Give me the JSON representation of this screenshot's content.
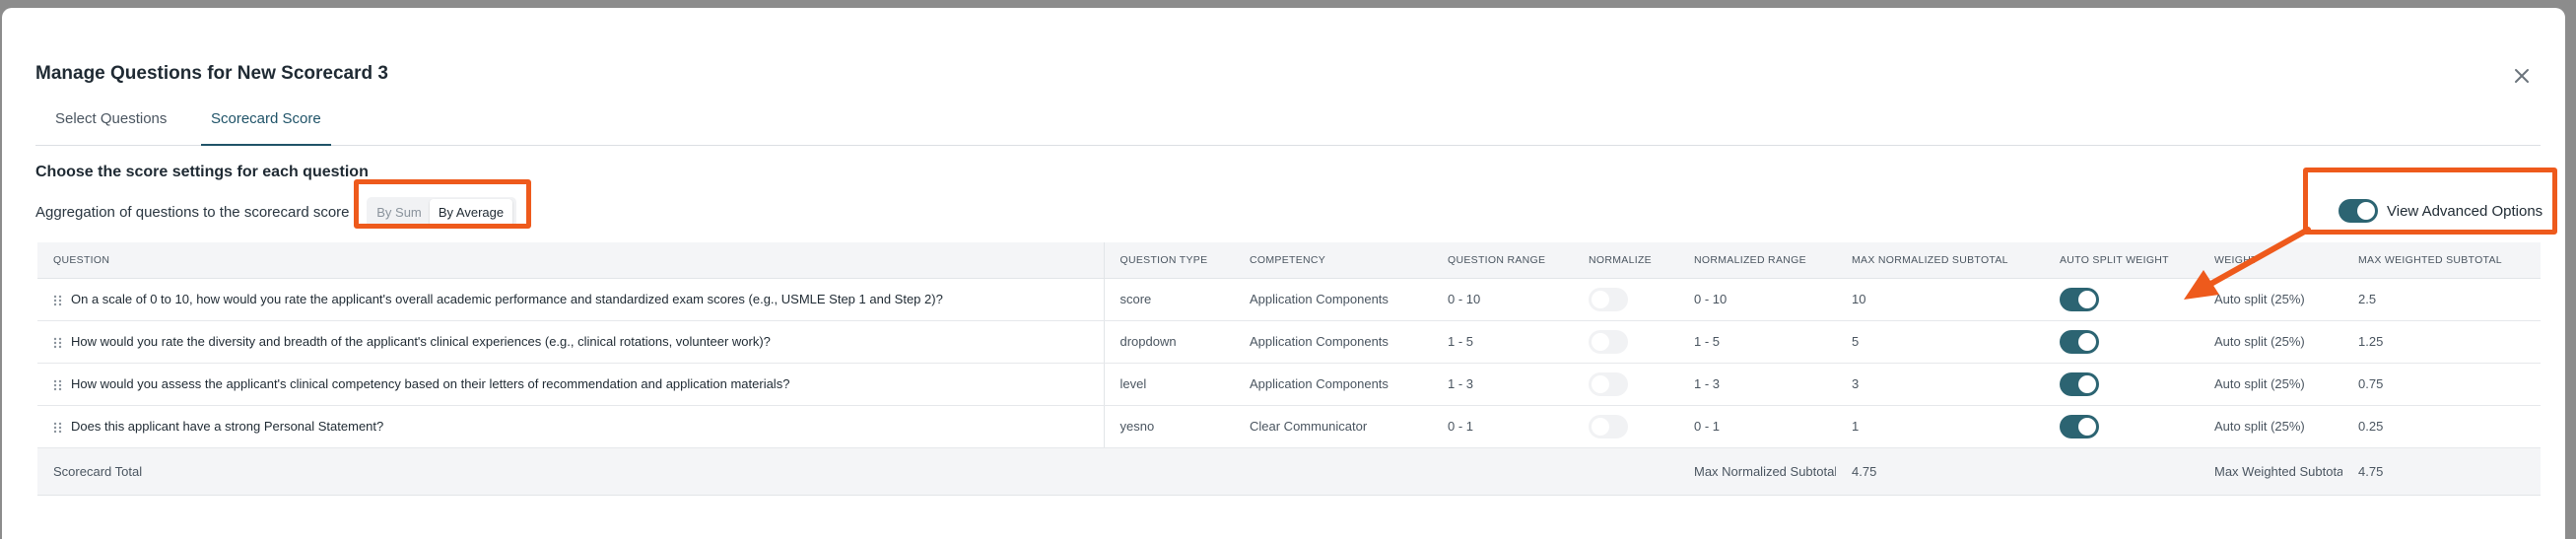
{
  "modal": {
    "title": "Manage Questions for New Scorecard 3"
  },
  "tabs": [
    {
      "label": "Select Questions",
      "active": false
    },
    {
      "label": "Scorecard Score",
      "active": true
    }
  ],
  "settings": {
    "heading": "Choose the score settings for each question",
    "aggregation_label": "Aggregation of questions to the scorecard score",
    "options": [
      "By Sum",
      "By Average"
    ],
    "selected": "By Average",
    "advanced_label": "View Advanced Options",
    "advanced_on": true
  },
  "table": {
    "headers": [
      "QUESTION",
      "QUESTION TYPE",
      "COMPETENCY",
      "QUESTION RANGE",
      "NORMALIZE",
      "NORMALIZED RANGE",
      "MAX NORMALIZED SUBTOTAL",
      "AUTO SPLIT WEIGHT",
      "WEIGHT",
      "MAX WEIGHTED SUBTOTAL"
    ],
    "rows": [
      {
        "question": "On a scale of 0 to 10, how would you rate the applicant's overall academic performance and standardized exam scores (e.g., USMLE Step 1 and Step 2)?",
        "type": "score",
        "competency": "Application Components",
        "range": "0 - 10",
        "normalize": false,
        "normalized_range": "0 - 10",
        "max_normalized": "10",
        "auto_split": true,
        "weight": "Auto split (25%)",
        "max_weighted": "2.5"
      },
      {
        "question": "How would you rate the diversity and breadth of the applicant's clinical experiences (e.g., clinical rotations, volunteer work)?",
        "type": "dropdown",
        "competency": "Application Components",
        "range": "1 - 5",
        "normalize": false,
        "normalized_range": "1 - 5",
        "max_normalized": "5",
        "auto_split": true,
        "weight": "Auto split (25%)",
        "max_weighted": "1.25"
      },
      {
        "question": "How would you assess the applicant's clinical competency based on their letters of recommendation and application materials?",
        "type": "level",
        "competency": "Application Components",
        "range": "1 - 3",
        "normalize": false,
        "normalized_range": "1 - 3",
        "max_normalized": "3",
        "auto_split": true,
        "weight": "Auto split (25%)",
        "max_weighted": "0.75"
      },
      {
        "question": "Does this applicant have a strong Personal Statement?",
        "type": "yesno",
        "competency": "Clear Communicator",
        "range": "0 - 1",
        "normalize": false,
        "normalized_range": "0 - 1",
        "max_normalized": "1",
        "auto_split": true,
        "weight": "Auto split (25%)",
        "max_weighted": "0.25"
      }
    ],
    "total": {
      "label": "Scorecard Total",
      "max_normalized_label": "Max Normalized Subtotal",
      "max_normalized_value": "4.75",
      "max_weighted_label": "Max Weighted Subtotal",
      "max_weighted_value": "4.75"
    }
  },
  "colors": {
    "accent": "#2c6472",
    "highlight": "#ee5a1c"
  }
}
